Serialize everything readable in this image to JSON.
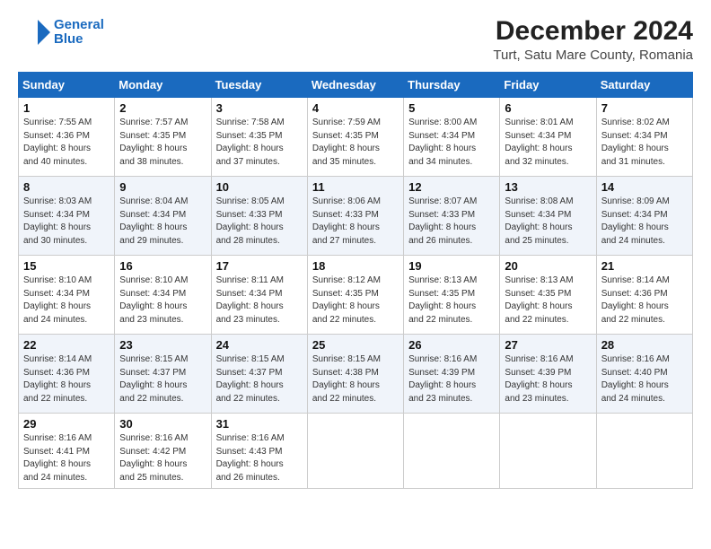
{
  "header": {
    "logo_line1": "General",
    "logo_line2": "Blue",
    "main_title": "December 2024",
    "subtitle": "Turt, Satu Mare County, Romania"
  },
  "weekdays": [
    "Sunday",
    "Monday",
    "Tuesday",
    "Wednesday",
    "Thursday",
    "Friday",
    "Saturday"
  ],
  "weeks": [
    [
      {
        "day": "1",
        "sunrise": "7:55 AM",
        "sunset": "4:36 PM",
        "daylight": "8 hours and 40 minutes."
      },
      {
        "day": "2",
        "sunrise": "7:57 AM",
        "sunset": "4:35 PM",
        "daylight": "8 hours and 38 minutes."
      },
      {
        "day": "3",
        "sunrise": "7:58 AM",
        "sunset": "4:35 PM",
        "daylight": "8 hours and 37 minutes."
      },
      {
        "day": "4",
        "sunrise": "7:59 AM",
        "sunset": "4:35 PM",
        "daylight": "8 hours and 35 minutes."
      },
      {
        "day": "5",
        "sunrise": "8:00 AM",
        "sunset": "4:34 PM",
        "daylight": "8 hours and 34 minutes."
      },
      {
        "day": "6",
        "sunrise": "8:01 AM",
        "sunset": "4:34 PM",
        "daylight": "8 hours and 32 minutes."
      },
      {
        "day": "7",
        "sunrise": "8:02 AM",
        "sunset": "4:34 PM",
        "daylight": "8 hours and 31 minutes."
      }
    ],
    [
      {
        "day": "8",
        "sunrise": "8:03 AM",
        "sunset": "4:34 PM",
        "daylight": "8 hours and 30 minutes."
      },
      {
        "day": "9",
        "sunrise": "8:04 AM",
        "sunset": "4:34 PM",
        "daylight": "8 hours and 29 minutes."
      },
      {
        "day": "10",
        "sunrise": "8:05 AM",
        "sunset": "4:33 PM",
        "daylight": "8 hours and 28 minutes."
      },
      {
        "day": "11",
        "sunrise": "8:06 AM",
        "sunset": "4:33 PM",
        "daylight": "8 hours and 27 minutes."
      },
      {
        "day": "12",
        "sunrise": "8:07 AM",
        "sunset": "4:33 PM",
        "daylight": "8 hours and 26 minutes."
      },
      {
        "day": "13",
        "sunrise": "8:08 AM",
        "sunset": "4:34 PM",
        "daylight": "8 hours and 25 minutes."
      },
      {
        "day": "14",
        "sunrise": "8:09 AM",
        "sunset": "4:34 PM",
        "daylight": "8 hours and 24 minutes."
      }
    ],
    [
      {
        "day": "15",
        "sunrise": "8:10 AM",
        "sunset": "4:34 PM",
        "daylight": "8 hours and 24 minutes."
      },
      {
        "day": "16",
        "sunrise": "8:10 AM",
        "sunset": "4:34 PM",
        "daylight": "8 hours and 23 minutes."
      },
      {
        "day": "17",
        "sunrise": "8:11 AM",
        "sunset": "4:34 PM",
        "daylight": "8 hours and 23 minutes."
      },
      {
        "day": "18",
        "sunrise": "8:12 AM",
        "sunset": "4:35 PM",
        "daylight": "8 hours and 22 minutes."
      },
      {
        "day": "19",
        "sunrise": "8:13 AM",
        "sunset": "4:35 PM",
        "daylight": "8 hours and 22 minutes."
      },
      {
        "day": "20",
        "sunrise": "8:13 AM",
        "sunset": "4:35 PM",
        "daylight": "8 hours and 22 minutes."
      },
      {
        "day": "21",
        "sunrise": "8:14 AM",
        "sunset": "4:36 PM",
        "daylight": "8 hours and 22 minutes."
      }
    ],
    [
      {
        "day": "22",
        "sunrise": "8:14 AM",
        "sunset": "4:36 PM",
        "daylight": "8 hours and 22 minutes."
      },
      {
        "day": "23",
        "sunrise": "8:15 AM",
        "sunset": "4:37 PM",
        "daylight": "8 hours and 22 minutes."
      },
      {
        "day": "24",
        "sunrise": "8:15 AM",
        "sunset": "4:37 PM",
        "daylight": "8 hours and 22 minutes."
      },
      {
        "day": "25",
        "sunrise": "8:15 AM",
        "sunset": "4:38 PM",
        "daylight": "8 hours and 22 minutes."
      },
      {
        "day": "26",
        "sunrise": "8:16 AM",
        "sunset": "4:39 PM",
        "daylight": "8 hours and 23 minutes."
      },
      {
        "day": "27",
        "sunrise": "8:16 AM",
        "sunset": "4:39 PM",
        "daylight": "8 hours and 23 minutes."
      },
      {
        "day": "28",
        "sunrise": "8:16 AM",
        "sunset": "4:40 PM",
        "daylight": "8 hours and 24 minutes."
      }
    ],
    [
      {
        "day": "29",
        "sunrise": "8:16 AM",
        "sunset": "4:41 PM",
        "daylight": "8 hours and 24 minutes."
      },
      {
        "day": "30",
        "sunrise": "8:16 AM",
        "sunset": "4:42 PM",
        "daylight": "8 hours and 25 minutes."
      },
      {
        "day": "31",
        "sunrise": "8:16 AM",
        "sunset": "4:43 PM",
        "daylight": "8 hours and 26 minutes."
      },
      null,
      null,
      null,
      null
    ]
  ]
}
